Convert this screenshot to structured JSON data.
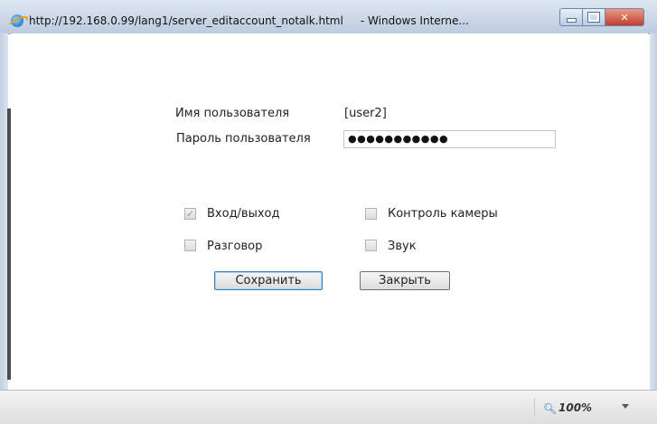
{
  "window": {
    "url": "http://192.168.0.99/lang1/server_editaccount_notalk.html",
    "title_suffix": "- Windows Interne..."
  },
  "form": {
    "username_label": "Имя пользователя",
    "username_value": "[user2]",
    "password_label": "Пароль пользователя",
    "password_value": "●●●●●●●●●●●",
    "permissions": {
      "login_logout": {
        "label": "Вход/выход",
        "checked": true,
        "disabled": true
      },
      "camera_control": {
        "label": "Контроль камеры",
        "checked": false
      },
      "talk": {
        "label": "Разговор",
        "checked": false
      },
      "sound": {
        "label": "Звук",
        "checked": false
      }
    },
    "save_label": "Сохранить",
    "close_label": "Закрыть"
  },
  "statusbar": {
    "zoom": "100%"
  }
}
